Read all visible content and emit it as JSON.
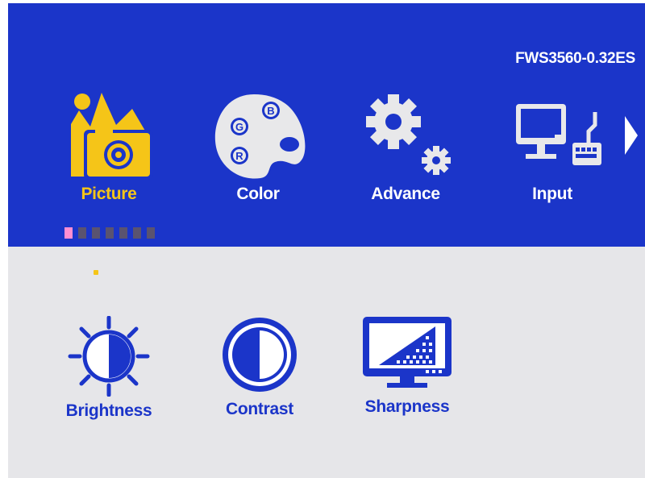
{
  "osd": {
    "model": "FWS3560-0.32ES",
    "tabs": [
      {
        "label": "Picture",
        "icon": "picture-icon",
        "active": true
      },
      {
        "label": "Color",
        "icon": "palette-icon",
        "active": false
      },
      {
        "label": "Advance",
        "icon": "gears-icon",
        "active": false
      },
      {
        "label": "Input",
        "icon": "monitor-keyboard-icon",
        "active": false
      }
    ],
    "next_icon": "chevron-right-icon",
    "page_dots": {
      "count": 7,
      "current": 1
    },
    "palette_letters": [
      "B",
      "G",
      "R"
    ],
    "sub_items": [
      {
        "label": "Brightness",
        "icon": "sun-icon"
      },
      {
        "label": "Contrast",
        "icon": "contrast-icon"
      },
      {
        "label": "Sharpness",
        "icon": "sharpness-monitor-icon"
      }
    ]
  },
  "colors": {
    "background": "#e6e6e9",
    "header": "#1b35c9",
    "accent_active": "#f5c518",
    "text_light": "#ffffff",
    "text_dark": "#1b35c9",
    "page_dot_current": "#ff8ed2",
    "page_dot_inactive": "#5a5370"
  }
}
